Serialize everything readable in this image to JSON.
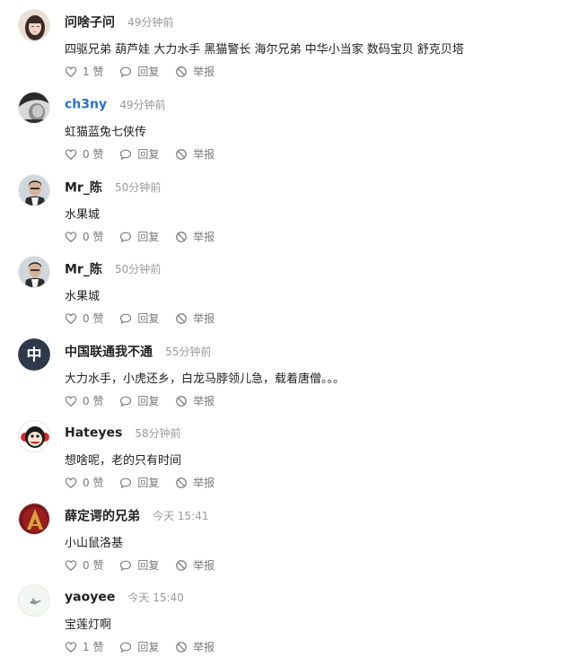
{
  "actions": {
    "like_suffix": "赞",
    "reply": "回复",
    "report": "举报"
  },
  "comments": [
    {
      "name": "问啥子问",
      "time": "49分钟前",
      "text": "四驱兄弟 葫芦娃 大力水手 黑猫警长 海尔兄弟 中华小当家 数码宝贝 舒克贝塔",
      "likes": "1",
      "avatar": "avatar-photo-woman",
      "name_color": "#222222"
    },
    {
      "name": "ch3ny",
      "time": "49分钟前",
      "text": "虹猫蓝兔七侠传",
      "likes": "0",
      "avatar": "avatar-photo-bw",
      "name_color": "#2a72c7"
    },
    {
      "name": "Mr_陈",
      "time": "50分钟前",
      "text": "水果城",
      "likes": "0",
      "avatar": "avatar-photo-man",
      "name_color": "#222222"
    },
    {
      "name": "Mr_陈",
      "time": "50分钟前",
      "text": "水果城",
      "likes": "0",
      "avatar": "avatar-photo-man",
      "name_color": "#222222"
    },
    {
      "name": "中国联通我不通",
      "time": "55分钟前",
      "text": "大力水手，小虎还乡，白龙马脖领儿急，载着唐僧。。。",
      "likes": "0",
      "avatar": "avatar-letter",
      "avatar_letter": "中",
      "name_color": "#222222"
    },
    {
      "name": "Hateyes",
      "time": "58分钟前",
      "text": "想啥呢，老的只有时间",
      "likes": "0",
      "avatar": "avatar-monkey",
      "name_color": "#222222"
    },
    {
      "name": "薛定谔的兄弟",
      "time": "今天 15:41",
      "text": "小山鼠洛基",
      "likes": "0",
      "avatar": "avatar-assassin-emblem",
      "name_color": "#222222"
    },
    {
      "name": "yaoyee",
      "time": "今天 15:40",
      "text": "宝莲灯啊",
      "likes": "1",
      "avatar": "avatar-bird",
      "name_color": "#222222"
    }
  ]
}
